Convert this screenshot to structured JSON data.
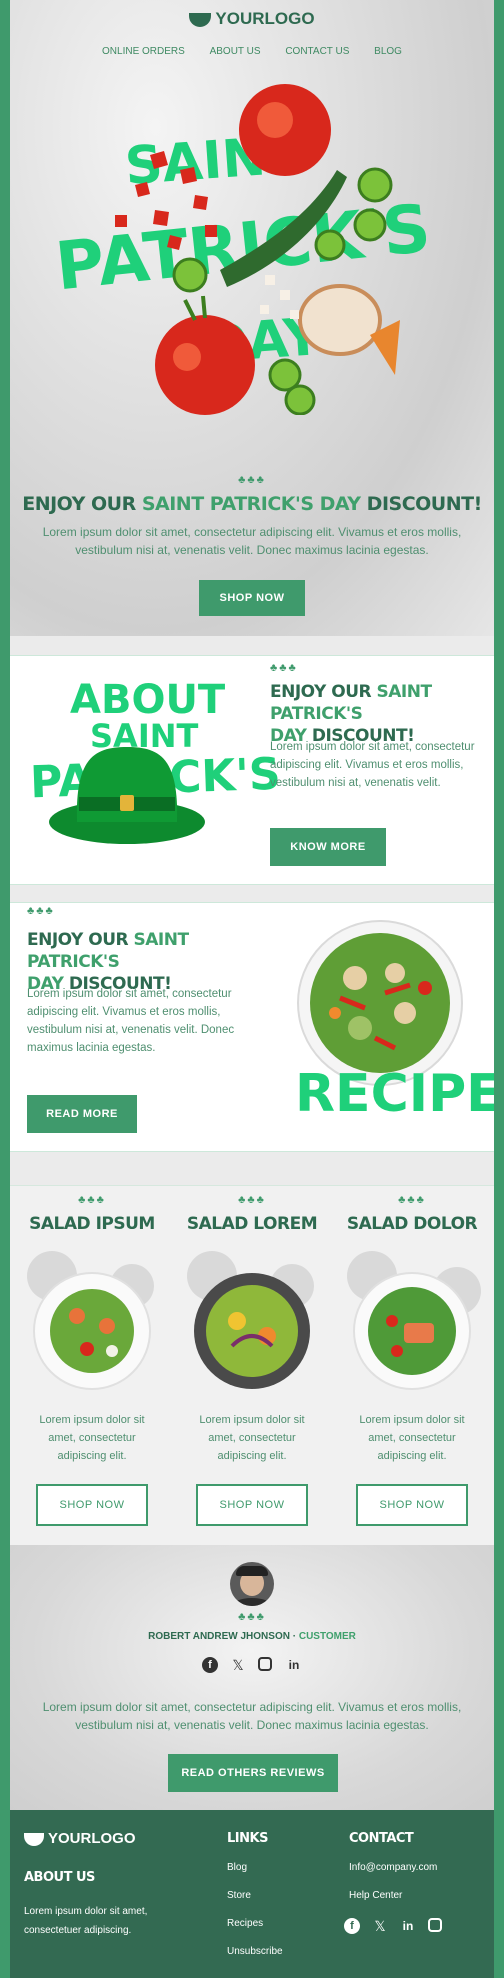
{
  "header": {
    "logo_text": "YOURLOGO",
    "nav": [
      "ONLINE ORDERS",
      "ABOUT US",
      "CONTACT US",
      "BLOG"
    ]
  },
  "hero": {
    "art_words": [
      "SAINT",
      "PATRICK'S",
      "DAY"
    ],
    "clover": "♣♣♣",
    "title_prefix": "ENJOY OUR ",
    "title_highlight": "SAINT PATRICK'S DAY",
    "title_suffix": " DISCOUNT!",
    "text": "Lorem ipsum dolor sit amet, consectetur adipiscing elit. Vivamus et eros mollis, vestibulum nisi at, venenatis velit. Donec maximus lacinia egestas.",
    "button": "SHOP NOW"
  },
  "promo1": {
    "art_words": [
      "ABOUT",
      "SAINT",
      "PATRICK'S"
    ],
    "clover": "♣♣♣",
    "title_prefix": "ENJOY OUR ",
    "title_highlight": "SAINT PATRICK'S",
    "title_line2_highlight": "DAY",
    "title_suffix": " DISCOUNT!",
    "text": "Lorem ipsum dolor sit amet, consectetur adipiscing elit. Vivamus et eros mollis, vestibulum nisi at, venenatis velit.",
    "button": "KNOW MORE"
  },
  "promo2": {
    "art_word": "RECIPE",
    "clover": "♣♣♣",
    "title_prefix": "ENJOY OUR ",
    "title_highlight": "SAINT PATRICK'S",
    "title_line2_highlight": "DAY",
    "title_suffix": " DISCOUNT!",
    "text": "Lorem ipsum dolor sit amet, consectetur adipiscing elit. Vivamus et eros mollis, vestibulum nisi at, venenatis velit. Donec maximus lacinia egestas.",
    "button": "READ MORE"
  },
  "salads": [
    {
      "clover": "♣♣♣",
      "title": "SALAD IPSUM",
      "text": "Lorem ipsum dolor sit amet, consectetur adipiscing elit.",
      "button": "SHOP NOW"
    },
    {
      "clover": "♣♣♣",
      "title": "SALAD LOREM",
      "text": "Lorem ipsum dolor sit amet, consectetur adipiscing elit.",
      "button": "SHOP NOW"
    },
    {
      "clover": "♣♣♣",
      "title": "SALAD DOLOR",
      "text": "Lorem ipsum dolor sit amet, consectetur adipiscing elit.",
      "button": "SHOP NOW"
    }
  ],
  "review": {
    "clover": "♣♣♣",
    "name": "ROBERT ANDREW JHONSON",
    "separator": " · ",
    "role": "CUSTOMER",
    "social_icons": [
      "facebook-icon",
      "x-icon",
      "instagram-icon",
      "linkedin-icon"
    ],
    "text": "Lorem ipsum dolor sit amet, consectetur adipiscing elit. Vivamus et eros mollis, vestibulum nisi at, venenatis velit. Donec maximus lacinia egestas.",
    "button": "READ OTHERS REVIEWS"
  },
  "footer": {
    "logo_text": "YOURLOGO",
    "about_title": "ABOUT US",
    "about_text": "Lorem ipsum dolor sit amet, consectetuer adipiscing.",
    "links_title": "LINKS",
    "links": [
      "Blog",
      "Store",
      "Recipes",
      "Unsubscribe"
    ],
    "contact_title": "CONTACT",
    "contact": [
      "Info@company.com",
      "Help Center"
    ],
    "social_icons": [
      "facebook-icon",
      "x-icon",
      "linkedin-icon",
      "instagram-icon"
    ]
  },
  "colors": {
    "brand_green": "#3f9a6c",
    "dark_green": "#2e6a50",
    "accent_green": "#1fd07a",
    "footer_bg": "#336a52"
  }
}
